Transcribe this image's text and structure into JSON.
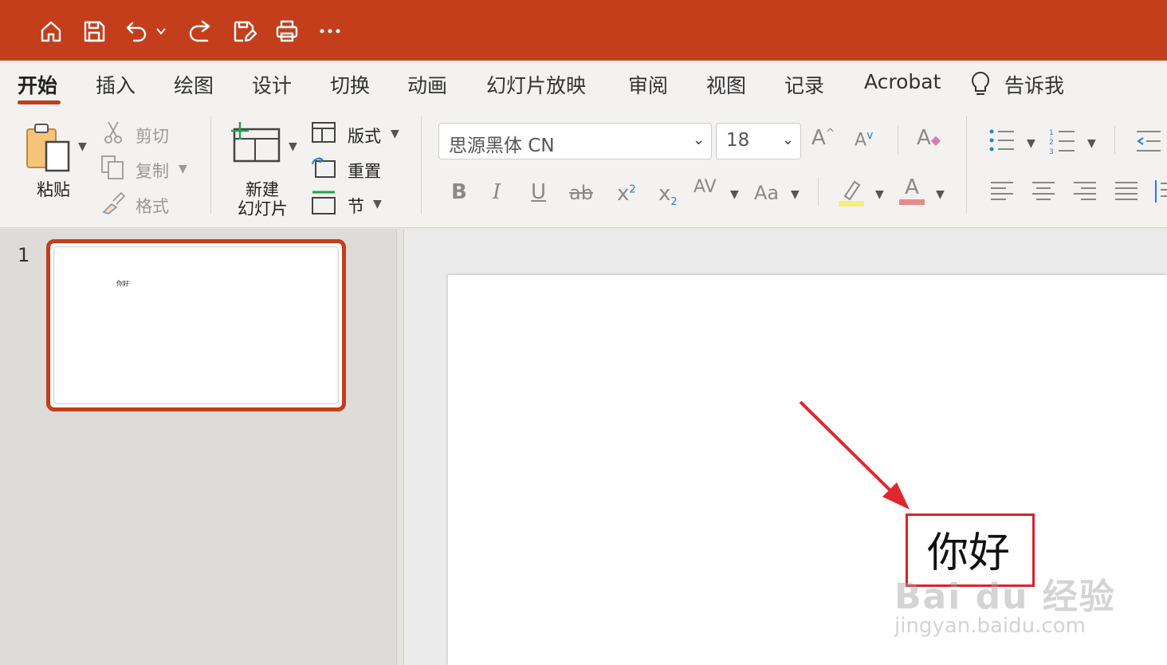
{
  "colors": {
    "accent": "#c43e1c",
    "annotation_red": "#d9232e"
  },
  "toolbar": {
    "icons": [
      "home-icon",
      "save-icon",
      "undo-icon",
      "redo-icon",
      "save-as-icon",
      "print-icon",
      "more-icon"
    ],
    "more_label": "···"
  },
  "tabs": [
    {
      "label": "开始",
      "active": true
    },
    {
      "label": "插入"
    },
    {
      "label": "绘图"
    },
    {
      "label": "设计"
    },
    {
      "label": "切换"
    },
    {
      "label": "动画"
    },
    {
      "label": "幻灯片放映"
    },
    {
      "label": "审阅"
    },
    {
      "label": "视图"
    },
    {
      "label": "记录"
    },
    {
      "label": "Acrobat"
    },
    {
      "label": "告诉我"
    }
  ],
  "clipboard": {
    "paste": "粘贴",
    "cut": "剪切",
    "copy": "复制",
    "format": "格式"
  },
  "slides_group": {
    "new_slide_line1": "新建",
    "new_slide_line2": "幻灯片",
    "layout": "版式",
    "reset": "重置",
    "section": "节"
  },
  "font": {
    "name": "思源黑体 CN",
    "size": "18"
  },
  "format_buttons": {
    "bold": "B",
    "italic": "I",
    "underline": "U",
    "strike": "ab",
    "superscript": "x",
    "subscript": "x",
    "spacing": "AV",
    "case": "Aa",
    "grow": "A",
    "shrink": "A",
    "clear": "A",
    "font_color": "A"
  },
  "thumbnails": [
    {
      "number": "1",
      "text": "你好"
    }
  ],
  "slide": {
    "text": "你好"
  },
  "watermark": {
    "main": "Bai du 经验",
    "sub": "jingyan.baidu.com"
  }
}
